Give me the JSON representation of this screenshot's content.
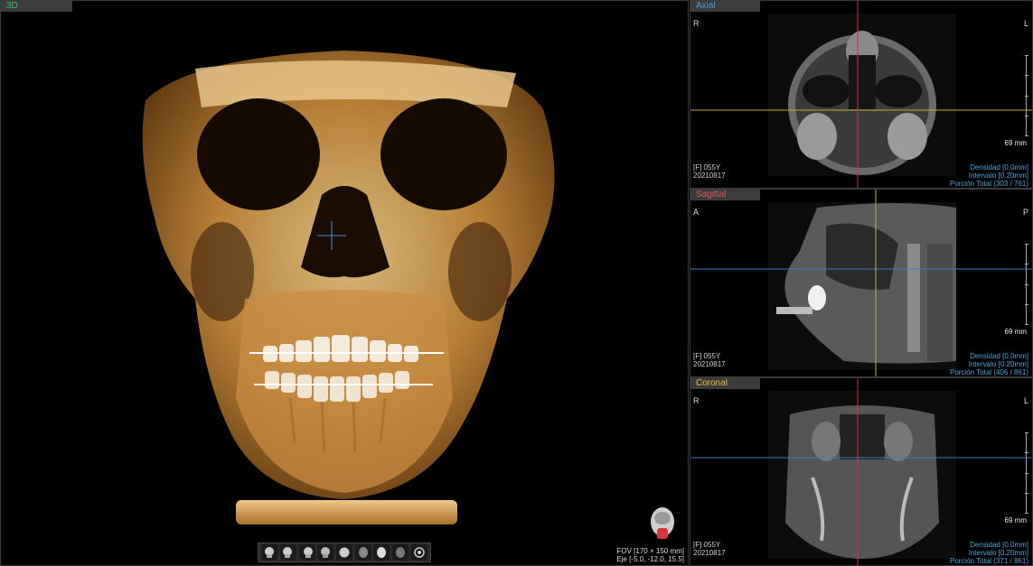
{
  "panels": {
    "view3d": {
      "title": "3D",
      "fov": "FOV [170 × 150 mm]",
      "eje": "Eje [-5.0, -12.0, 15.5]"
    },
    "axial": {
      "title": "Axial",
      "left_label": "R",
      "right_label": "L",
      "scale": "69 mm",
      "patient": "[F] 055Y",
      "date": "20210817",
      "densidad": "Densidad [0.0mm]",
      "intervalo": "Intervalo [0.20mm]",
      "porcion": "Porción Total (303 / 761)"
    },
    "sagittal": {
      "title": "Sagittal",
      "left_label": "A",
      "right_label": "P",
      "scale": "69 mm",
      "patient": "[F] 055Y",
      "date": "20210817",
      "densidad": "Densidad [0.0mm]",
      "intervalo": "Intervalo [0.20mm]",
      "porcion": "Porción Total (406 / 861)"
    },
    "coronal": {
      "title": "Coronal",
      "left_label": "R",
      "right_label": "L",
      "scale": "69 mm",
      "patient": "[F] 055Y",
      "date": "20210817",
      "densidad": "Densidad [0.0mm]",
      "intervalo": "Intervalo [0.20mm]",
      "porcion": "Porción Total (371 / 861)"
    }
  },
  "toolbar": {
    "buttons": [
      "view-front-icon",
      "view-left-icon",
      "view-right-icon",
      "view-back-icon",
      "view-top-icon",
      "view-bottom-icon",
      "opacity-icon",
      "reset-view-icon",
      "rotate-icon"
    ]
  },
  "colors": {
    "axial_title": "#3fa0e6",
    "sagittal_title": "#e05a5a",
    "coronal_title": "#e8b83a",
    "view3d_title": "#38c070",
    "axial_line": "#c0b23a",
    "vertical_line": "#c03a3a",
    "horizontal_line": "#3a7ac8"
  }
}
